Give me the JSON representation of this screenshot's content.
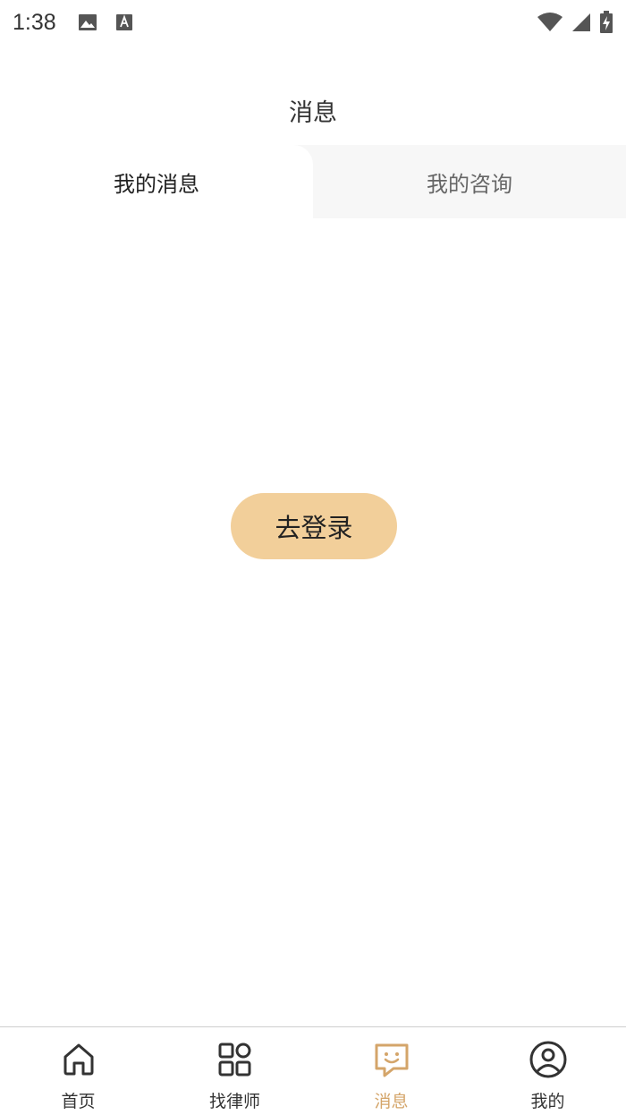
{
  "status_bar": {
    "time": "1:38",
    "icons": [
      "image-icon",
      "text-icon",
      "wifi-icon",
      "signal-icon",
      "battery-icon"
    ]
  },
  "header": {
    "title": "消息"
  },
  "tabs": [
    {
      "label": "我的消息",
      "active": true
    },
    {
      "label": "我的咨询",
      "active": false
    }
  ],
  "main": {
    "login_button_label": "去登录"
  },
  "bottom_nav": {
    "items": [
      {
        "label": "首页",
        "icon": "home-icon",
        "active": false
      },
      {
        "label": "找律师",
        "icon": "grid-icon",
        "active": false
      },
      {
        "label": "消息",
        "icon": "message-icon",
        "active": true
      },
      {
        "label": "我的",
        "icon": "user-icon",
        "active": false
      }
    ]
  },
  "colors": {
    "accent": "#d4a56a",
    "button_bg": "#f2cf9a",
    "tab_bg": "#f7f7f7"
  }
}
